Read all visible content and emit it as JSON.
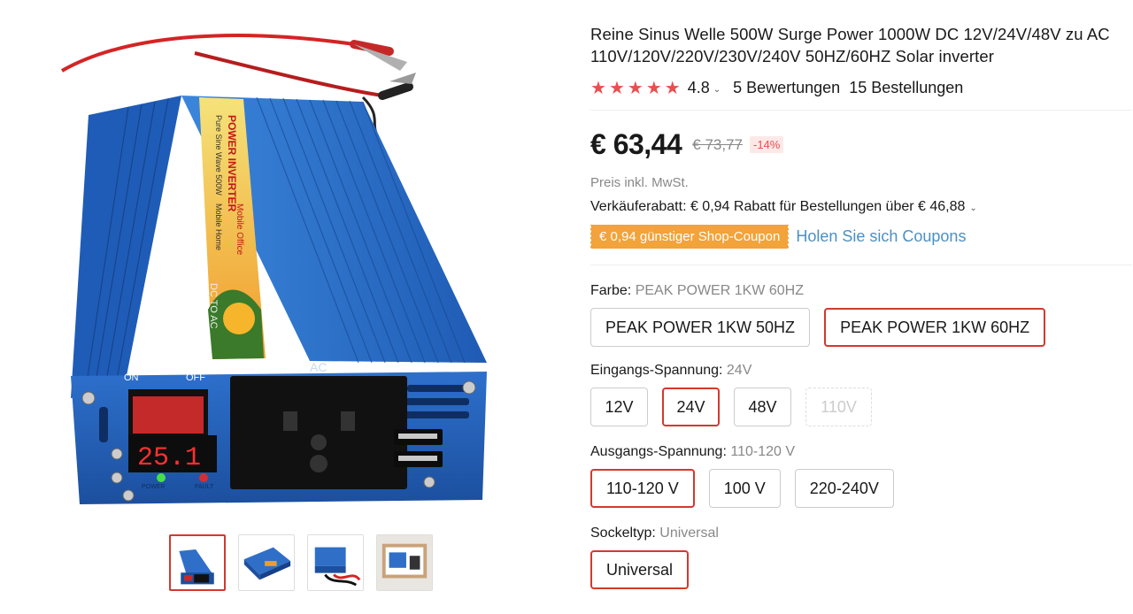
{
  "product": {
    "title": "Reine Sinus Welle 500W Surge Power 1000W DC 12V/24V/48V zu AC 110V/120V/220V/230V/240V 50HZ/60HZ Solar inverter",
    "rating": "4.8",
    "stars": 5,
    "reviews": "5 Bewertungen",
    "orders": "15 Bestellungen",
    "price": "€ 63,44",
    "old_price": "€ 73,77",
    "discount": "-14%",
    "tax_note": "Preis inkl. MwSt.",
    "seller_discount": "Verkäuferabatt: € 0,94 Rabatt für Bestellungen über € 46,88",
    "coupon_label": "€ 0,94 günstiger Shop-Coupon",
    "coupon_link": "Holen Sie sich Coupons"
  },
  "image": {
    "device_text_top": "POWER INVERTER",
    "device_text_sub": "Pure Sine Wave 500W",
    "device_text_mobile": "Mobile Office",
    "device_text_home": "Mobile Home",
    "device_text_dc": "DC TO AC",
    "panel_ac": "AC",
    "switch_on": "ON",
    "switch_off": "OFF",
    "display": "25.1",
    "led_power": "POWER",
    "led_fault": "FAULT"
  },
  "options": {
    "color": {
      "label": "Farbe:",
      "selected": "PEAK POWER 1KW 60HZ",
      "items": [
        "PEAK POWER 1KW 50HZ",
        "PEAK POWER 1KW 60HZ"
      ]
    },
    "input": {
      "label": "Eingangs-Spannung:",
      "selected": "24V",
      "items": [
        "12V",
        "24V",
        "48V",
        "110V"
      ]
    },
    "output": {
      "label": "Ausgangs-Spannung:",
      "selected": "110-120 V",
      "items": [
        "110-120 V",
        "100 V",
        "220-240V"
      ]
    },
    "socket": {
      "label": "Sockeltyp:",
      "selected": "Universal",
      "items": [
        "Universal"
      ]
    }
  },
  "colors": {
    "accent": "#d2392f",
    "star": "#e94f4f",
    "coupon": "#f2a33a",
    "link": "#4a90c4",
    "device_blue": "#2f6fc7"
  }
}
